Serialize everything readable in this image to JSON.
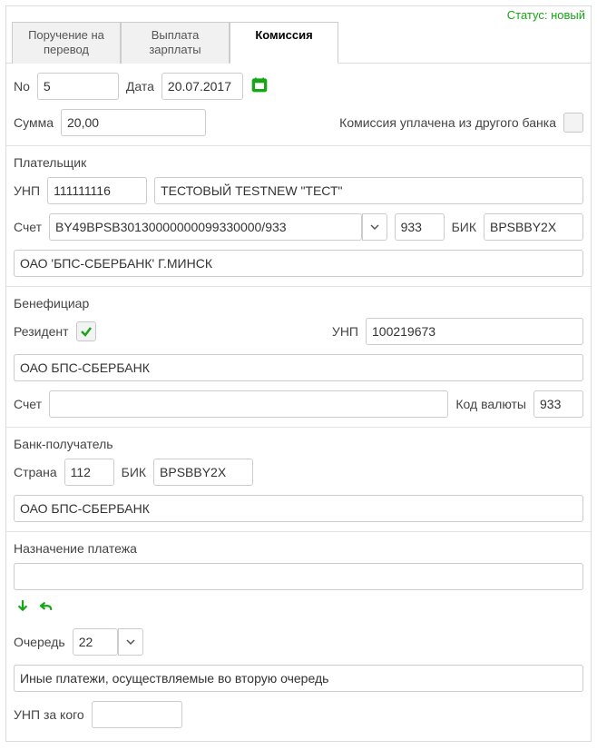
{
  "status": "Статус: новый",
  "tabs": {
    "transfer": "Поручение на\nперевод",
    "salary": "Выплата\nзарплаты",
    "commission": "Комиссия"
  },
  "header": {
    "no_label": "No",
    "no_value": "5",
    "date_label": "Дата",
    "date_value": "20.07.2017",
    "sum_label": "Сумма",
    "sum_value": "20,00",
    "paid_other_bank": "Комиссия уплачена из другого банка"
  },
  "payer": {
    "title": "Плательщик",
    "unp_label": "УНП",
    "unp_value": "111111116",
    "name": "ТЕСТОВЫЙ TESTNEW \"ТЕСТ\"",
    "account_label": "Счет",
    "account_value": "BY49BPSB30130000000099330000/933",
    "currency": "933",
    "bic_label": "БИК",
    "bic_value": "BPSBBY2X",
    "bank_name": "ОАО 'БПС-СБЕРБАНК' Г.МИНСК"
  },
  "beneficiary": {
    "title": "Бенефициар",
    "resident_label": "Резидент",
    "resident_checked": true,
    "unp_label": "УНП",
    "unp_value": "100219673",
    "name": "ОАО БПС-СБЕРБАНК",
    "account_label": "Счет",
    "account_value": "",
    "curr_label": "Код валюты",
    "curr_value": "933"
  },
  "recipient_bank": {
    "title": "Банк-получатель",
    "country_label": "Страна",
    "country_value": "112",
    "bic_label": "БИК",
    "bic_value": "BPSBBY2X",
    "bank_name": "ОАО БПС-СБЕРБАНК"
  },
  "purpose": {
    "title": "Назначение платежа",
    "text": "",
    "queue_label": "Очередь",
    "queue_value": "22",
    "queue_desc": "Иные платежи, осуществляемые во вторую очередь",
    "unp_for_label": "УНП за кого",
    "unp_for_value": ""
  }
}
